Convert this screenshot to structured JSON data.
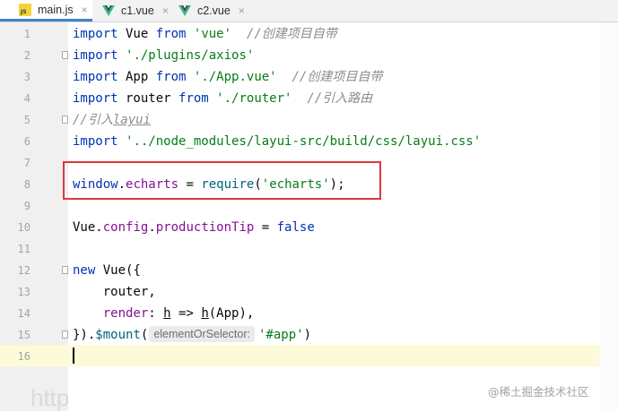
{
  "tabs": [
    {
      "label": "main.js",
      "icon": "js-file-icon",
      "active": true
    },
    {
      "label": "c1.vue",
      "icon": "vue-file-icon",
      "active": false
    },
    {
      "label": "c2.vue",
      "icon": "vue-file-icon",
      "active": false
    }
  ],
  "js_badge": "JS",
  "tab_close_glyph": "×",
  "lines": [
    {
      "n": "1",
      "t": [
        [
          "import",
          "kw"
        ],
        [
          " Vue ",
          ""
        ],
        [
          "from",
          "kw"
        ],
        [
          " ",
          ""
        ],
        [
          "'vue'",
          "str"
        ],
        [
          "  ",
          ""
        ],
        [
          "//创建项目自带",
          "cm"
        ]
      ]
    },
    {
      "n": "2",
      "t": [
        [
          "import",
          "kw"
        ],
        [
          " ",
          ""
        ],
        [
          "'./plugins/axios'",
          "str"
        ]
      ]
    },
    {
      "n": "3",
      "t": [
        [
          "import",
          "kw"
        ],
        [
          " App ",
          ""
        ],
        [
          "from",
          "kw"
        ],
        [
          " ",
          ""
        ],
        [
          "'./App.vue'",
          "str"
        ],
        [
          "  ",
          ""
        ],
        [
          "//创建项目自带",
          "cm"
        ]
      ]
    },
    {
      "n": "4",
      "t": [
        [
          "import",
          "kw"
        ],
        [
          " router ",
          ""
        ],
        [
          "from",
          "kw"
        ],
        [
          " ",
          ""
        ],
        [
          "'./router'",
          "str"
        ],
        [
          "  ",
          ""
        ],
        [
          "//引入路由",
          "cm"
        ]
      ]
    },
    {
      "n": "5",
      "t": [
        [
          "//引入",
          "cm"
        ],
        [
          "layui",
          "cm ul"
        ]
      ]
    },
    {
      "n": "6",
      "t": [
        [
          "import",
          "kw"
        ],
        [
          " ",
          ""
        ],
        [
          "'../node_modules/layui-src/build/css/layui.css'",
          "str"
        ]
      ]
    },
    {
      "n": "7",
      "t": []
    },
    {
      "n": "8",
      "t": [
        [
          "window",
          "kw"
        ],
        [
          ".",
          ""
        ],
        [
          "echarts",
          "prop"
        ],
        [
          " = ",
          ""
        ],
        [
          "require",
          "fn"
        ],
        [
          "(",
          ""
        ],
        [
          "'echarts'",
          "str"
        ],
        [
          ");",
          ""
        ]
      ]
    },
    {
      "n": "9",
      "t": []
    },
    {
      "n": "10",
      "t": [
        [
          "Vue",
          ""
        ],
        [
          ".",
          ""
        ],
        [
          "config",
          "prop"
        ],
        [
          ".",
          ""
        ],
        [
          "productionTip",
          "prop"
        ],
        [
          " = ",
          ""
        ],
        [
          "false",
          "kw"
        ]
      ]
    },
    {
      "n": "11",
      "t": []
    },
    {
      "n": "12",
      "t": [
        [
          "new",
          "kw"
        ],
        [
          " Vue({",
          ""
        ]
      ]
    },
    {
      "n": "13",
      "t": [
        [
          "    router,",
          ""
        ]
      ]
    },
    {
      "n": "14",
      "t": [
        [
          "    ",
          ""
        ],
        [
          "render",
          "prop"
        ],
        [
          ": ",
          ""
        ],
        [
          "h",
          "ul"
        ],
        [
          " => ",
          ""
        ],
        [
          "h",
          "ul"
        ],
        [
          "(App),",
          ""
        ]
      ]
    },
    {
      "n": "15",
      "t": [
        [
          "}).",
          ""
        ],
        [
          "$mount",
          "fn"
        ],
        [
          "(",
          ""
        ],
        [
          "elementOrSelector:",
          "hint"
        ],
        [
          "'#app'",
          "str"
        ],
        [
          ")",
          ""
        ]
      ]
    },
    {
      "n": "16",
      "t": []
    }
  ],
  "watermark_left": "http",
  "watermark_right": "@稀土掘金技术社区",
  "colors": {
    "keyword": "#0033b3",
    "string": "#067d17",
    "comment": "#8c8c8c",
    "property": "#871094",
    "function": "#00627a",
    "highlight_box": "#e0363c",
    "active_tab_underline": "#4083c9",
    "current_line": "#fcfad9"
  }
}
